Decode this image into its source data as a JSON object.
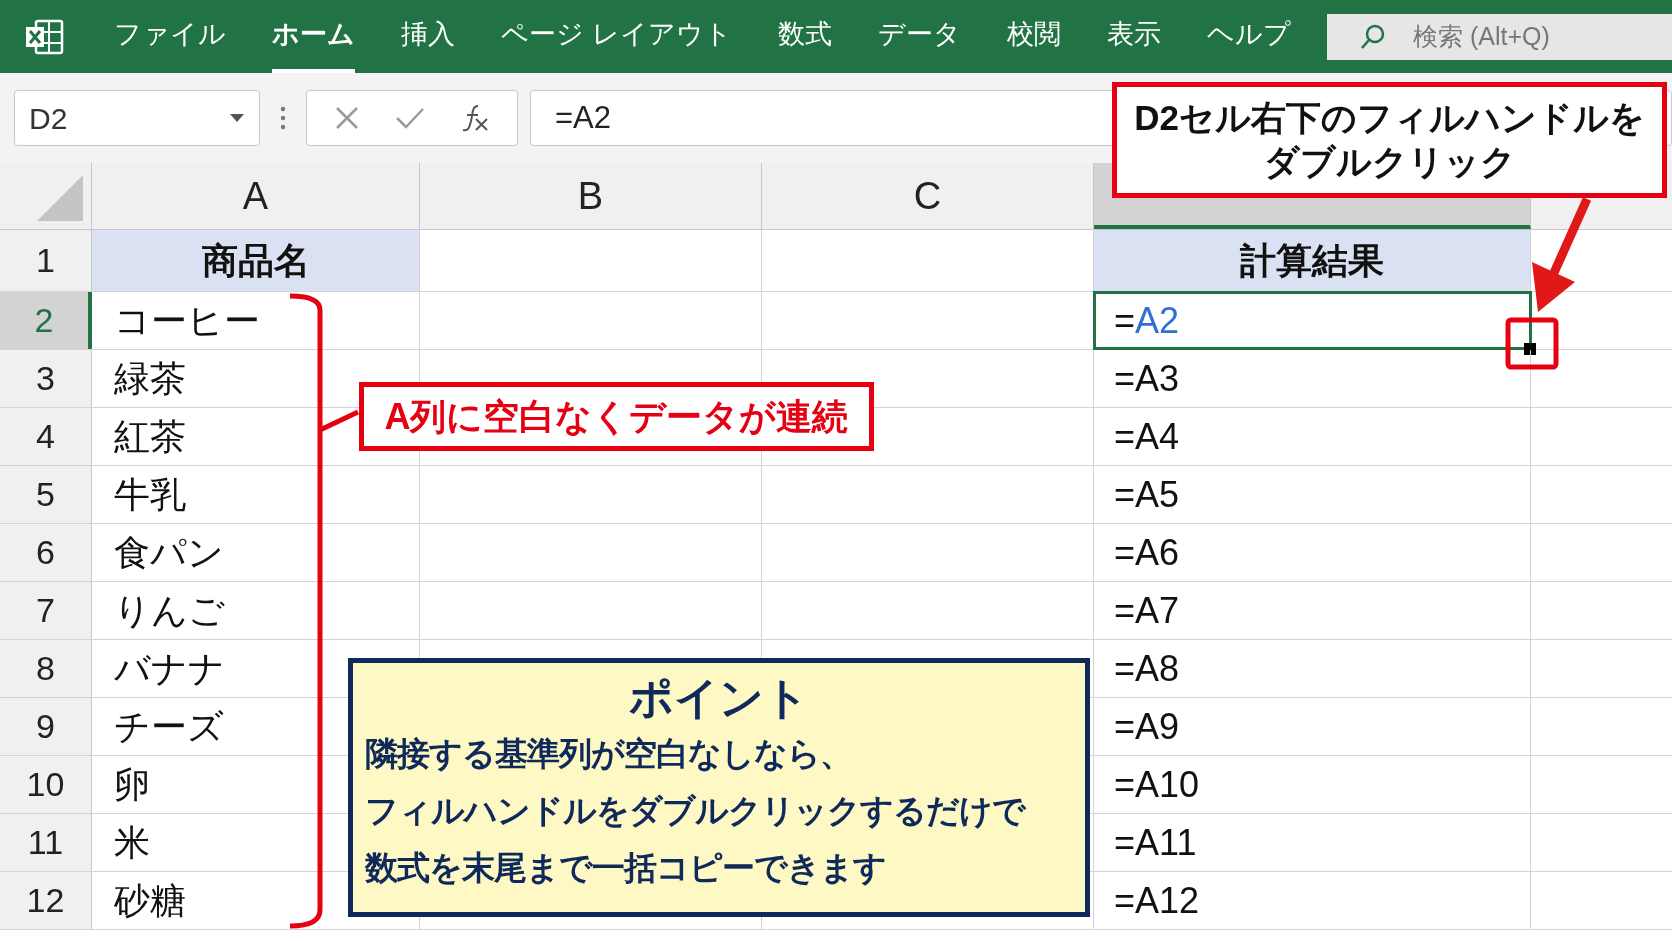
{
  "ribbon": {
    "tabs": [
      {
        "label": "ファイル",
        "selected": false
      },
      {
        "label": "ホーム",
        "selected": true
      },
      {
        "label": "挿入",
        "selected": false
      },
      {
        "label": "ページ レイアウト",
        "selected": false
      },
      {
        "label": "数式",
        "selected": false
      },
      {
        "label": "データ",
        "selected": false
      },
      {
        "label": "校閲",
        "selected": false
      },
      {
        "label": "表示",
        "selected": false
      },
      {
        "label": "ヘルプ",
        "selected": false
      }
    ],
    "search": {
      "placeholder": "検索 (Alt+Q)"
    }
  },
  "formula_bar": {
    "name_box": "D2",
    "formula": "=A2"
  },
  "columns": [
    {
      "letter": "A",
      "selected": false
    },
    {
      "letter": "B",
      "selected": false
    },
    {
      "letter": "C",
      "selected": false
    },
    {
      "selected": true
    }
  ],
  "rows": [
    {
      "number": "1",
      "selected": false,
      "header_row": true,
      "a": "商品名",
      "d": {
        "ref": "計算結果",
        "highlighted": false
      }
    },
    {
      "number": "2",
      "selected": true,
      "header_row": false,
      "a": "コーヒー",
      "d": {
        "sign": "=",
        "ref": "A2",
        "highlighted": true
      }
    },
    {
      "number": "3",
      "selected": false,
      "header_row": false,
      "a": "緑茶",
      "d": {
        "sign": "=",
        "ref": "A3",
        "highlighted": false
      }
    },
    {
      "number": "4",
      "selected": false,
      "header_row": false,
      "a": "紅茶",
      "d": {
        "sign": "=",
        "ref": "A4",
        "highlighted": false
      }
    },
    {
      "number": "5",
      "selected": false,
      "header_row": false,
      "a": "牛乳",
      "d": {
        "sign": "=",
        "ref": "A5",
        "highlighted": false
      }
    },
    {
      "number": "6",
      "selected": false,
      "header_row": false,
      "a": "食パン",
      "d": {
        "sign": "=",
        "ref": "A6",
        "highlighted": false
      }
    },
    {
      "number": "7",
      "selected": false,
      "header_row": false,
      "a": "りんご",
      "d": {
        "sign": "=",
        "ref": "A7",
        "highlighted": false
      }
    },
    {
      "number": "8",
      "selected": false,
      "header_row": false,
      "a": "バナナ",
      "d": {
        "sign": "=",
        "ref": "A8",
        "highlighted": false
      }
    },
    {
      "number": "9",
      "selected": false,
      "header_row": false,
      "a": "チーズ",
      "d": {
        "sign": "=",
        "ref": "A9",
        "highlighted": false
      }
    },
    {
      "number": "10",
      "selected": false,
      "header_row": false,
      "a": "卵",
      "d": {
        "sign": "=",
        "ref": "A10",
        "highlighted": false
      }
    },
    {
      "number": "11",
      "selected": false,
      "header_row": false,
      "a": "米",
      "d": {
        "sign": "=",
        "ref": "A11",
        "highlighted": false
      }
    },
    {
      "number": "12",
      "selected": false,
      "header_row": false,
      "a": "砂糖",
      "d": {
        "sign": "=",
        "ref": "A12",
        "highlighted": false
      }
    }
  ],
  "annotations": {
    "callout": [
      "D2セル右下のフィルハンドルを",
      "ダブルクリック"
    ],
    "bracket_label": "A列に空白なくデータが連続",
    "point": {
      "title": "ポイント",
      "lines": [
        "隣接する基準列が空白なしなら、",
        "フィルハンドルをダブルクリックするだけで",
        "数式を末尾まで一括コピーできます"
      ]
    }
  }
}
